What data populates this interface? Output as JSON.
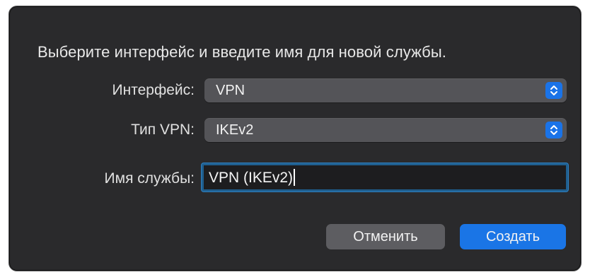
{
  "dialog": {
    "prompt": "Выберите интерфейс и введите имя для новой службы.",
    "interface": {
      "label": "Интерфейс:",
      "value": "VPN"
    },
    "vpn_type": {
      "label": "Тип VPN:",
      "value": "IKEv2"
    },
    "service_name": {
      "label": "Имя службы:",
      "value": "VPN (IKEv2)"
    },
    "buttons": {
      "cancel": "Отменить",
      "create": "Создать"
    }
  },
  "colors": {
    "dialog_bg": "#2a2a2c",
    "popup_bg": "#545458",
    "accent": "#1a75e6",
    "field_focus": "#2f7fbf"
  },
  "icons": {
    "popup_stepper": "chevron-up-down-icon"
  }
}
